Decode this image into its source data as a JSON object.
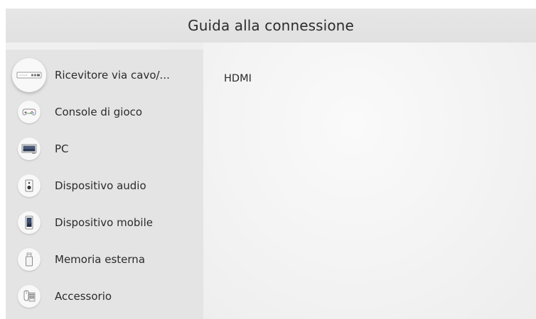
{
  "header": {
    "title": "Guida alla connessione"
  },
  "sidebar": {
    "items": [
      {
        "label": "Ricevitore via cavo/...",
        "icon": "set-top-box-icon",
        "selected": true
      },
      {
        "label": "Console di gioco",
        "icon": "gamepad-icon",
        "selected": false
      },
      {
        "label": "PC",
        "icon": "pc-monitor-icon",
        "selected": false
      },
      {
        "label": "Dispositivo audio",
        "icon": "speaker-icon",
        "selected": false
      },
      {
        "label": "Dispositivo mobile",
        "icon": "smartphone-icon",
        "selected": false
      },
      {
        "label": "Memoria esterna",
        "icon": "usb-drive-icon",
        "selected": false
      },
      {
        "label": "Accessorio",
        "icon": "mouse-keyboard-icon",
        "selected": false
      }
    ]
  },
  "main": {
    "connection_type": "HDMI"
  },
  "colors": {
    "header_bg": "#e3e3e3",
    "sidebar_bg": "#e4e4e4",
    "main_bg": "#f5f5f5",
    "text": "#2b2b2b"
  }
}
